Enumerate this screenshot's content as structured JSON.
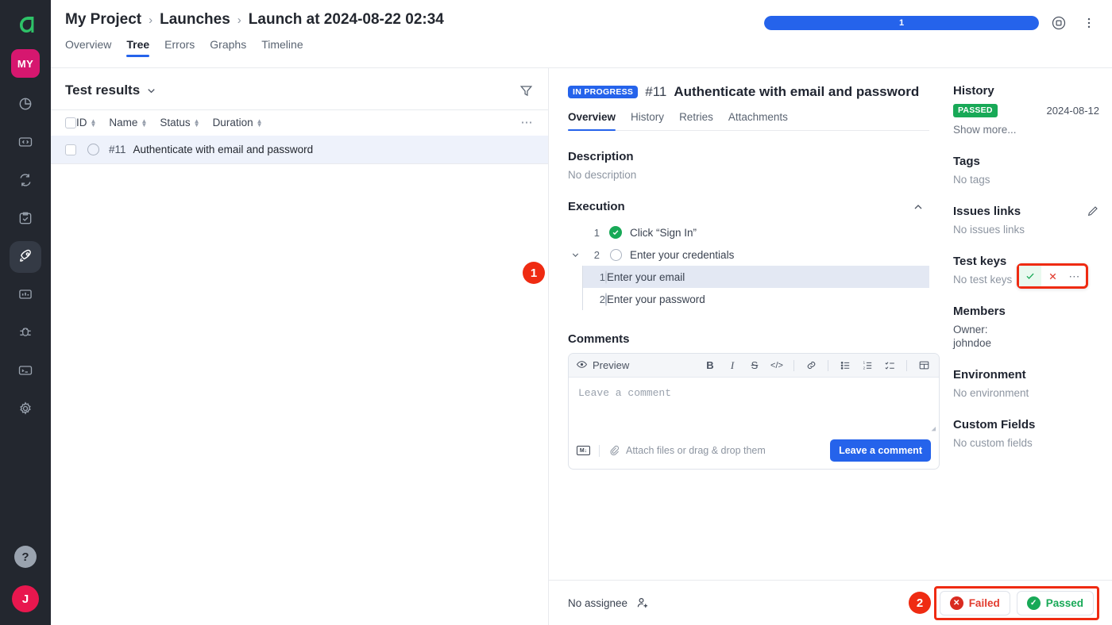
{
  "rail": {
    "logo_icon": "allure-logo-icon",
    "project_badge": "MY",
    "items": [
      {
        "name": "dashboards",
        "icon": "pie-chart-icon"
      },
      {
        "name": "api",
        "icon": "code-brackets-icon"
      },
      {
        "name": "automation",
        "icon": "refresh-cycle-icon"
      },
      {
        "name": "test-plans",
        "icon": "clipboard-check-icon"
      },
      {
        "name": "launches",
        "icon": "rocket-icon",
        "active": true
      },
      {
        "name": "analytics",
        "icon": "bar-chart-icon"
      },
      {
        "name": "defects",
        "icon": "bug-icon"
      },
      {
        "name": "console",
        "icon": "terminal-icon"
      },
      {
        "name": "settings",
        "icon": "gear-icon"
      }
    ],
    "help_label": "?",
    "avatar_initial": "J"
  },
  "header": {
    "breadcrumb": [
      "My Project",
      "Launches",
      "Launch at 2024-08-22 02:34"
    ],
    "separator": "›",
    "tabs": [
      {
        "label": "Overview",
        "active": false
      },
      {
        "label": "Tree",
        "active": true
      },
      {
        "label": "Errors",
        "active": false
      },
      {
        "label": "Graphs",
        "active": false
      },
      {
        "label": "Timeline",
        "active": false
      }
    ],
    "progress": {
      "label": "1",
      "percent": 100,
      "color": "#2563eb"
    },
    "stop_icon": "stop-circle-icon",
    "more_icon": "vertical-dots-icon"
  },
  "list_panel": {
    "title": "Test results",
    "caret_icon": "chevron-down-icon",
    "filter_icon": "filter-icon",
    "more_icon": "horizontal-dots-icon",
    "columns": [
      "ID",
      "Name",
      "Status",
      "Duration"
    ],
    "rows": [
      {
        "id": "#11",
        "name": "Authenticate with email and password",
        "status_icon": "circle-outline-icon",
        "selected": true
      }
    ]
  },
  "detail": {
    "status_pill": "IN PROGRESS",
    "test_number": "#11",
    "test_name": "Authenticate with email and password",
    "tabs": [
      {
        "label": "Overview",
        "active": true
      },
      {
        "label": "History",
        "active": false
      },
      {
        "label": "Retries",
        "active": false
      },
      {
        "label": "Attachments",
        "active": false
      }
    ],
    "description": {
      "heading": "Description",
      "value": "No description"
    },
    "execution": {
      "heading": "Execution",
      "collapse_icon": "chevron-up-icon",
      "steps": [
        {
          "index": "1",
          "label": "Click “Sign In”",
          "status": "passed"
        },
        {
          "index": "2",
          "label": "Enter your credentials",
          "status": "pending",
          "expandable": true,
          "children": [
            {
              "index": "1",
              "label": "Enter your email",
              "status": "pending",
              "selected": true
            },
            {
              "index": "2",
              "label": "Enter your password",
              "status": "pending"
            }
          ]
        }
      ]
    },
    "step_actions": {
      "pass_icon": "check-icon",
      "fail_icon": "cross-icon",
      "more_icon": "horizontal-dots-icon",
      "highlight_badge": "1"
    },
    "comments": {
      "heading": "Comments",
      "preview_label": "Preview",
      "preview_icon": "eye-icon",
      "toolbar": [
        {
          "name": "bold",
          "glyph": "B"
        },
        {
          "name": "italic",
          "glyph": "I"
        },
        {
          "name": "strikethrough",
          "glyph": "S"
        },
        {
          "name": "code",
          "glyph": "</>"
        },
        {
          "name": "link",
          "glyph": "🔗"
        },
        {
          "name": "bullet-list",
          "glyph": "•≡"
        },
        {
          "name": "numbered-list",
          "glyph": "1≡"
        },
        {
          "name": "checklist",
          "glyph": "✓≡"
        },
        {
          "name": "table",
          "glyph": "⊞"
        }
      ],
      "placeholder": "Leave a comment",
      "markdown_icon": "markdown-icon",
      "attach_icon": "paperclip-icon",
      "attach_label": "Attach files or drag & drop them",
      "submit_label": "Leave a comment"
    }
  },
  "meta": {
    "history": {
      "heading": "History",
      "status": "PASSED",
      "status_color": "#18a957",
      "date": "2024-08-12",
      "show_more": "Show more..."
    },
    "tags": {
      "heading": "Tags",
      "value": "No tags"
    },
    "issues": {
      "heading": "Issues links",
      "value": "No issues links",
      "edit_icon": "pencil-icon"
    },
    "test_keys": {
      "heading": "Test keys",
      "value": "No test keys"
    },
    "members": {
      "heading": "Members",
      "role": "Owner:",
      "user": "johndoe"
    },
    "environment": {
      "heading": "Environment",
      "value": "No environment"
    },
    "custom_fields": {
      "heading": "Custom Fields",
      "value": "No custom fields"
    }
  },
  "footer": {
    "assignee": "No assignee",
    "add_assignee_icon": "add-person-icon",
    "highlight_badge": "2",
    "failed_label": "Failed",
    "passed_label": "Passed",
    "failed_color": "#d92b20",
    "passed_color": "#18a957"
  }
}
